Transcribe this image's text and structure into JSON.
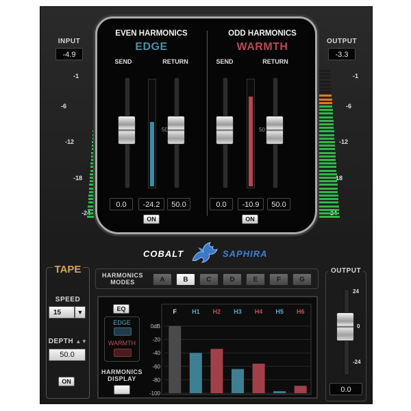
{
  "input": {
    "label": "INPUT",
    "value": "-4.9"
  },
  "output_top": {
    "label": "OUTPUT",
    "value": "-3.3"
  },
  "meter_scale": [
    "-1",
    "-6",
    "-12",
    "-18",
    "-24"
  ],
  "even": {
    "title": "EVEN HARMONICS",
    "subtitle": "EDGE",
    "subtitle_color": "#4e8fa6",
    "send_label": "SEND",
    "return_label": "RETURN",
    "send_scale": "0",
    "return_scale": "50",
    "send_value": "0.0",
    "meter_value": "-24.2",
    "return_value": "50.0",
    "meter_level": 0.6,
    "meter_color": "#3f8aa5",
    "on_label": "ON"
  },
  "odd": {
    "title": "ODD HARMONICS",
    "subtitle": "WARMTH",
    "subtitle_color": "#b94a52",
    "send_label": "SEND",
    "return_label": "RETURN",
    "send_scale": "0",
    "return_scale": "50",
    "send_value": "0.0",
    "meter_value": "-10.9",
    "return_value": "50.0",
    "meter_level": 0.84,
    "meter_color": "#b8454f",
    "on_label": "ON"
  },
  "brand": {
    "left": "COBALT",
    "right": "SAPHIRA"
  },
  "tape": {
    "title": "TAPE",
    "speed_label": "SPEED",
    "speed_value": "15",
    "depth_label": "DEPTH",
    "depth_value": "50.0",
    "on_label": "ON"
  },
  "modes": {
    "label_line1": "HARMONICS",
    "label_line2": "MODES",
    "buttons": [
      "A",
      "B",
      "C",
      "D",
      "E",
      "F",
      "G"
    ],
    "selected": "B"
  },
  "display": {
    "eq_label": "EQ",
    "edge_label": "EDGE",
    "warmth_label": "WARMTH",
    "harmonics_label_line1": "HARMONICS",
    "harmonics_label_line2": "DISPLAY"
  },
  "chart_data": {
    "type": "bar",
    "categories": [
      "F",
      "H1",
      "H2",
      "H3",
      "H4",
      "H5",
      "H6"
    ],
    "values": [
      0,
      -40,
      -34,
      -64,
      -56,
      -97,
      -89
    ],
    "colors": [
      "#4a4a4a",
      "#3f7f93",
      "#a2404a",
      "#3f7f93",
      "#a2404a",
      "#3f7f93",
      "#a2404a"
    ],
    "label_colors": [
      "#e0e0e0",
      "#5fa8c2",
      "#c2505a",
      "#5fa8c2",
      "#c2505a",
      "#5fa8c2",
      "#c2505a"
    ],
    "y_ticks": [
      "0dB",
      "-20",
      "-40",
      "-60",
      "-80",
      "-100"
    ],
    "ylim": [
      -100,
      0
    ]
  },
  "output_bottom": {
    "label": "OUTPUT",
    "scale": [
      "24",
      "0",
      "-24"
    ],
    "value": "0.0"
  }
}
